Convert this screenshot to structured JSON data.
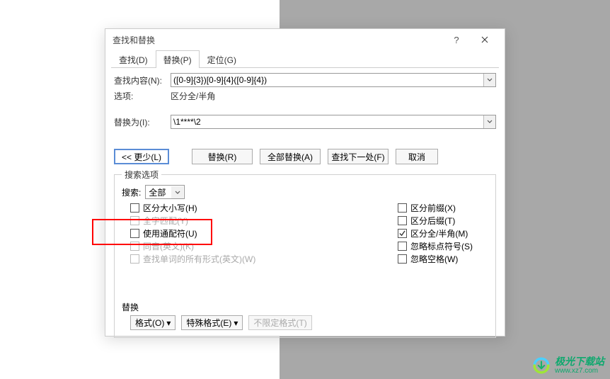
{
  "dialog": {
    "title": "查找和替换",
    "tabs": {
      "find": "查找(D)",
      "replace": "替换(P)",
      "goto": "定位(G)"
    },
    "find_label": "查找内容(N):",
    "find_value": "([0-9]{3})[0-9]{4}([0-9]{4})",
    "options_label": "选项:",
    "options_value": "区分全/半角",
    "replace_label": "替换为(I):",
    "replace_value": "\\1****\\2",
    "less_button": "<< 更少(L)",
    "btn_replace": "替换(R)",
    "btn_replace_all": "全部替换(A)",
    "btn_find_next": "查找下一处(F)",
    "btn_cancel": "取消",
    "search_options_legend": "搜索选项",
    "search_label": "搜索:",
    "search_scope": "全部",
    "checkboxes_left": [
      {
        "label": "区分大小写(H)",
        "checked": false,
        "disabled": false
      },
      {
        "label": "全字匹配(Y)",
        "checked": false,
        "disabled": true
      },
      {
        "label": "使用通配符(U)",
        "checked": false,
        "disabled": false
      },
      {
        "label": "同音(英文)(K)",
        "checked": false,
        "disabled": true
      },
      {
        "label": "查找单词的所有形式(英文)(W)",
        "checked": false,
        "disabled": true
      }
    ],
    "checkboxes_right": [
      {
        "label": "区分前缀(X)",
        "checked": false,
        "disabled": false
      },
      {
        "label": "区分后缀(T)",
        "checked": false,
        "disabled": false
      },
      {
        "label": "区分全/半角(M)",
        "checked": true,
        "disabled": false
      },
      {
        "label": "忽略标点符号(S)",
        "checked": false,
        "disabled": false
      },
      {
        "label": "忽略空格(W)",
        "checked": false,
        "disabled": false
      }
    ],
    "replace_section_label": "替换",
    "btn_format": "格式(O)",
    "btn_special": "特殊格式(E)",
    "btn_no_format": "不限定格式(T)"
  },
  "watermark": {
    "name": "极光下载站",
    "url": "www.xz7.com"
  }
}
